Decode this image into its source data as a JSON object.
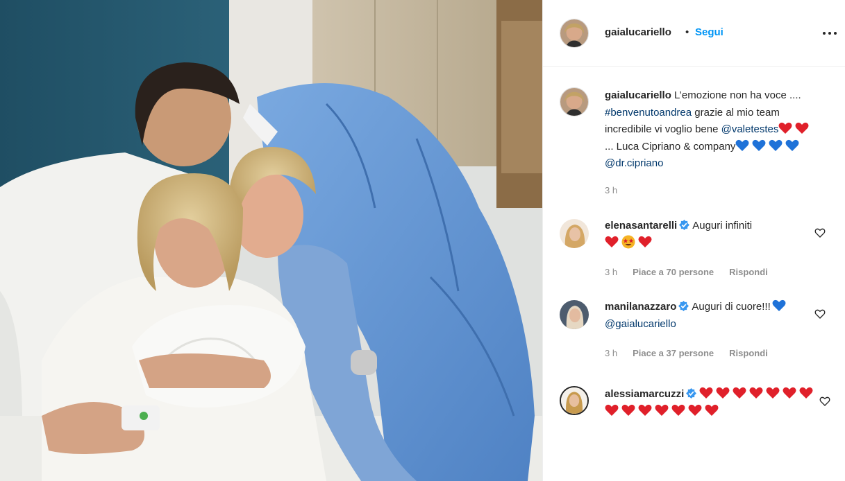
{
  "post": {
    "author": "gaialucariello",
    "follow_separator": "•",
    "follow_label": "Segui",
    "caption": {
      "text1": "L’emozione non ha voce ....",
      "hashtag": "#benvenutoandrea",
      "text2": "grazie al mio team incredibile vi voglio bene",
      "mention1": "@valetestes",
      "text3": "... Luca Cipriano & company",
      "mention2": "@dr.cipriano",
      "time": "3 h"
    }
  },
  "comments": [
    {
      "username": "elenasantarelli",
      "text": "Auguri infiniti",
      "time": "3 h",
      "likes": "Piace a 70 persone",
      "reply": "Rispondi"
    },
    {
      "username": "manilanazzaro",
      "text": "Auguri di cuore!!!",
      "mention": "@gaialucariello",
      "time": "3 h",
      "likes": "Piace a 37 persone",
      "reply": "Rispondi"
    },
    {
      "username": "alessiamarcuzzi"
    }
  ],
  "icons": {
    "more": "more-options-icon",
    "verified": "verified-badge-icon",
    "like": "heart-outline-icon",
    "red_heart": "red-heart-emoji",
    "blue_heart": "blue-heart-emoji",
    "star_eyes": "star-struck-emoji"
  },
  "colors": {
    "accent": "#0095f6",
    "link": "#00376b",
    "verified": "#3897f0",
    "meta_text": "#8e8e8e",
    "red_heart": "#e0202a",
    "blue_heart": "#1f72d8"
  }
}
